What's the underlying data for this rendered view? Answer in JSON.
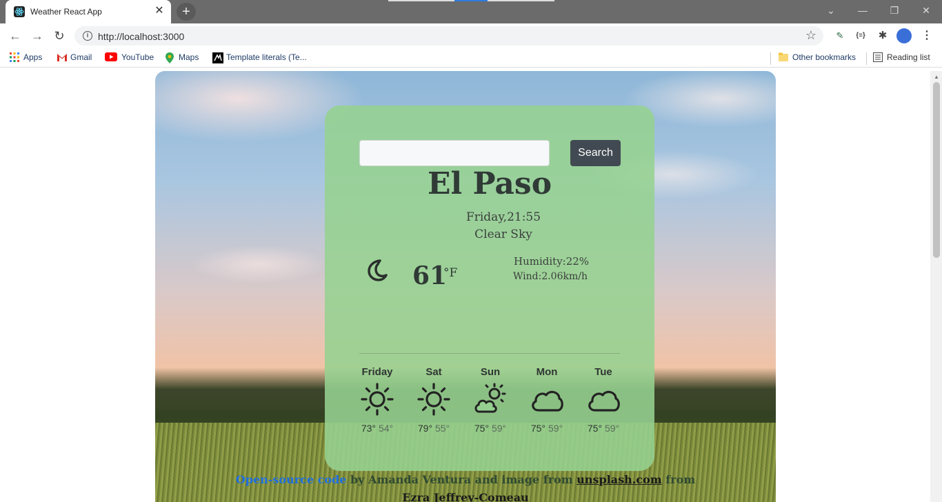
{
  "browser": {
    "tab_title": "Weather React App",
    "url": "http://localhost:3000",
    "bookmarks": [
      {
        "label": "Apps",
        "icon": "apps-grid-icon"
      },
      {
        "label": "Gmail",
        "icon": "gmail-icon"
      },
      {
        "label": "YouTube",
        "icon": "youtube-icon"
      },
      {
        "label": "Maps",
        "icon": "maps-pin-icon"
      },
      {
        "label": "Template literals (Te...",
        "icon": "mdn-icon"
      }
    ],
    "other_bookmarks": "Other bookmarks",
    "reading_list": "Reading list"
  },
  "weather": {
    "search": {
      "value": "",
      "placeholder": "",
      "button_label": "Search"
    },
    "city": "El Paso",
    "datetime": "Friday,21:55",
    "description": "Clear Sky",
    "current_icon": "moon-icon",
    "temperature": "61",
    "unit": "°F",
    "humidity": "Humidity:22%",
    "wind": "Wind:2.06km/h",
    "forecast": [
      {
        "day": "Friday",
        "icon": "sun-icon",
        "max": "73°",
        "min": "54°"
      },
      {
        "day": "Sat",
        "icon": "sun-icon",
        "max": "79°",
        "min": "55°"
      },
      {
        "day": "Sun",
        "icon": "partly-sunny-icon",
        "max": "75°",
        "min": "59°"
      },
      {
        "day": "Mon",
        "icon": "cloud-icon",
        "max": "75°",
        "min": "59°"
      },
      {
        "day": "Tue",
        "icon": "cloud-icon",
        "max": "75°",
        "min": "59°"
      }
    ]
  },
  "footer": {
    "open_source": "Open-source code",
    "by_text": " by Amanda Ventura and image from ",
    "unsplash": "unsplash.com",
    "from_text": " from",
    "author": "Ezra Jeffrey-Comeau"
  },
  "colors": {
    "card": "#96d291",
    "button": "#414a52",
    "link_blue": "#1f6fe0"
  }
}
